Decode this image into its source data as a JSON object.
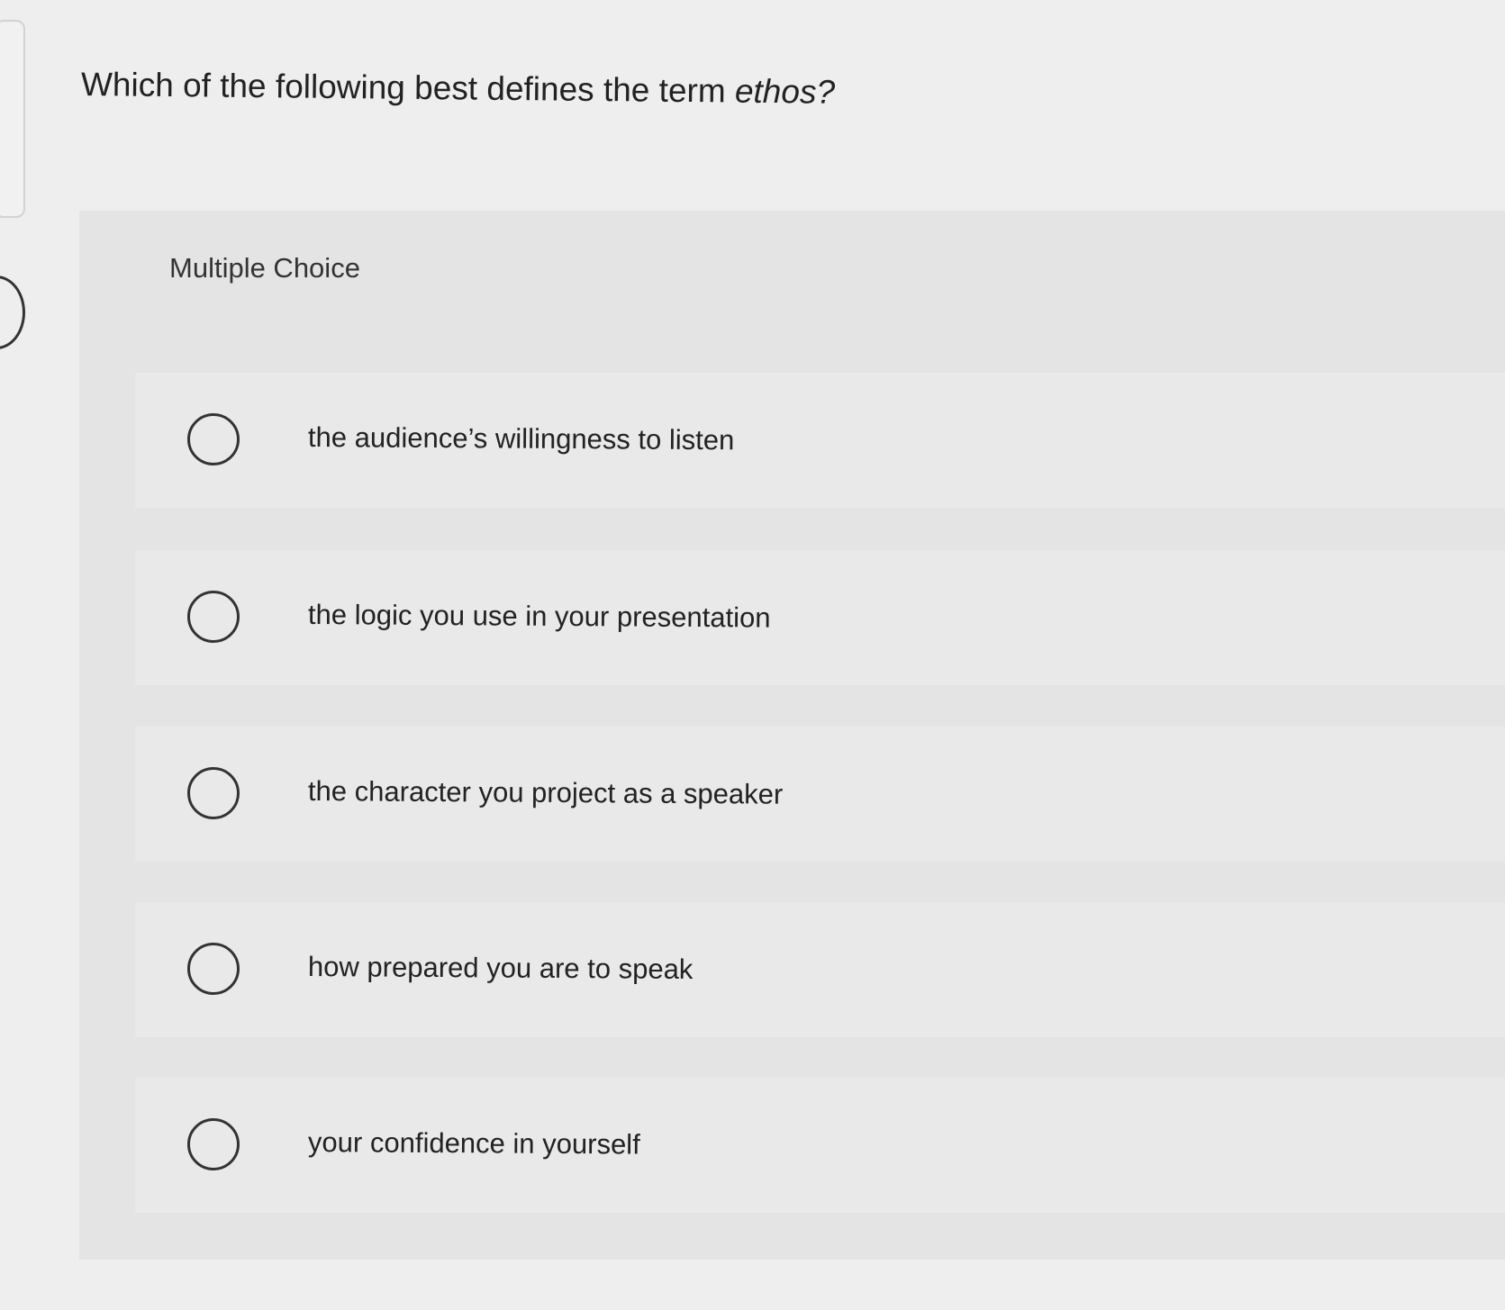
{
  "question": {
    "prompt_prefix": "Which of the following best defines the term ",
    "prompt_term": "ethos?"
  },
  "question_type": "Multiple Choice",
  "choices": [
    {
      "label": "the audience’s willingness to listen",
      "selected": false
    },
    {
      "label": "the logic you use in your presentation",
      "selected": false
    },
    {
      "label": "the character you project as a speaker",
      "selected": false
    },
    {
      "label": "how prepared you are to speak",
      "selected": false
    },
    {
      "label": "your confidence in yourself",
      "selected": false
    }
  ],
  "colors": {
    "page_background": "#eeeeee",
    "panel_background": "#e4e4e4",
    "choice_background": "#e9e9e9",
    "text": "#222222",
    "radio_border": "#333333"
  }
}
